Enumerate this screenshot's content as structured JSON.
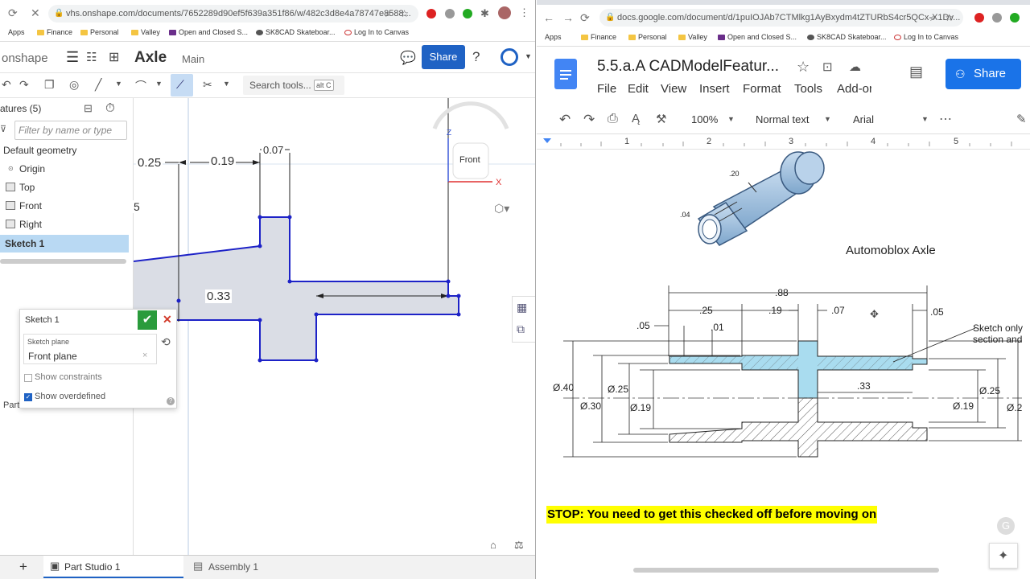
{
  "left": {
    "url": "vhs.onshape.com/documents/7652289d90ef5f639a351f86/w/482c3d8e4a78747e8588...",
    "bookmarks": [
      "Apps",
      "Finance",
      "Personal",
      "Valley",
      "Open and Closed S...",
      "SK8CAD Skateboar...",
      "Log In to Canvas"
    ],
    "app_name": "onshape",
    "doc_title": "Axle",
    "branch": "Main",
    "share_label": "Share",
    "search_placeholder": "Search tools...",
    "search_shortcut": "alt C",
    "features_header": "atures (5)",
    "filter_placeholder": "Filter by name or type",
    "tree": [
      "Default geometry",
      "Origin",
      "Top",
      "Front",
      "Right",
      "Sketch 1"
    ],
    "parts_label": "Part",
    "dims": {
      "d1": "0.25",
      "d2": "0.19",
      "d3": "0.07",
      "d4": "0.33",
      "d5": "5"
    },
    "view_cube_label": "Front",
    "axis_z": "Z",
    "axis_x": "X",
    "sketch_dialog": {
      "title": "Sketch 1",
      "plane_label": "Sketch plane",
      "plane_value": "Front plane",
      "show_constraints": "Show constraints",
      "show_overdefined": "Show overdefined"
    },
    "tabs": [
      "Part Studio 1",
      "Assembly 1"
    ]
  },
  "right": {
    "url": "docs.google.com/document/d/1puIOJAb7CTMlkg1AyBxydm4tZTURbS4cr5QCx-X1Dv...",
    "bookmarks": [
      "Apps",
      "Finance",
      "Personal",
      "Valley",
      "Open and Closed S...",
      "SK8CAD Skateboar...",
      "Log In to Canvas"
    ],
    "doc_title": "5.5.a.A CADModelFeatur...",
    "menu": [
      "File",
      "Edit",
      "View",
      "Insert",
      "Format",
      "Tools",
      "Add-or"
    ],
    "share_label": "Share",
    "zoom": "100%",
    "style": "Normal text",
    "font": "Arial",
    "ruler": [
      "1",
      "2",
      "3",
      "4",
      "5"
    ],
    "iso_labels": {
      "a": ".20",
      "b": ".04"
    },
    "caption": "Automoblox Axle",
    "drawing": {
      "top88": ".88",
      "d25": ".25",
      "d19": ".19",
      "d07": ".07",
      "d05a": ".05",
      "d05b": ".05",
      "d01": ".01",
      "note1": "Sketch only",
      "note2": "section and",
      "dia40": "Ø.40",
      "dia30": "Ø.30",
      "dia25l": "Ø.25",
      "dia19l": "Ø.19",
      "d33": ".33",
      "dia25r": "Ø.25",
      "dia19r": "Ø.19",
      "dia2": "Ø.2"
    },
    "stop_text": "STOP: You need to get this checked off before moving on"
  }
}
